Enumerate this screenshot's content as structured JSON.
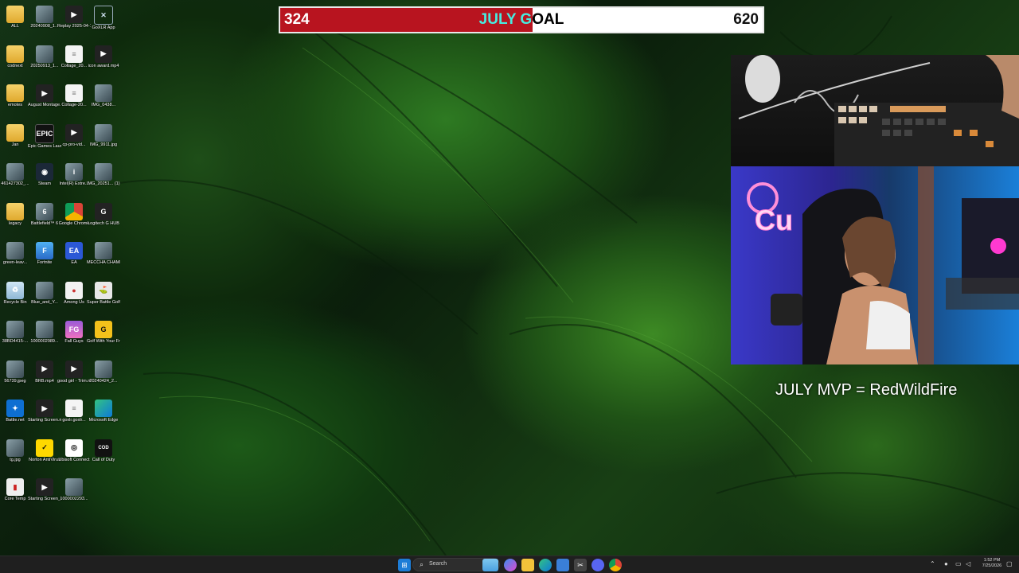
{
  "goal": {
    "current": "324",
    "title": "JULY GOAL",
    "target": "620",
    "progress_fraction": 0.523,
    "fill_color": "#b8141f"
  },
  "overlay": {
    "mvp_text": "JULY MVP = RedWildFire"
  },
  "desktop": {
    "icons": [
      {
        "label": "ALL",
        "icon": "folder-icon"
      },
      {
        "label": "20240908_1...",
        "icon": "image-icon"
      },
      {
        "label": "Replay 2025-04-11...",
        "icon": "video-icon"
      },
      {
        "label": "GoXLR App",
        "icon": "goxlr-icon"
      },
      {
        "label": "codnext",
        "icon": "folder-icon"
      },
      {
        "label": "20250913_1...",
        "icon": "image-icon"
      },
      {
        "label": "Collage_20...",
        "icon": "document-icon"
      },
      {
        "label": "icon award.mp4",
        "icon": "video-icon"
      },
      {
        "label": "emotes",
        "icon": "folder-icon"
      },
      {
        "label": "August Montage...",
        "icon": "video-icon"
      },
      {
        "label": "Collage-20...",
        "icon": "document-icon"
      },
      {
        "label": "IMG_0438...",
        "icon": "image-icon"
      },
      {
        "label": "Jan",
        "icon": "folder-icon"
      },
      {
        "label": "Epic Games Launcher",
        "icon": "epic-games-icon"
      },
      {
        "label": "cp-pro-vid...",
        "icon": "video-icon"
      },
      {
        "label": "IMG_9911.jpg",
        "icon": "image-icon"
      },
      {
        "label": "461427302_...",
        "icon": "image-icon"
      },
      {
        "label": "Steam",
        "icon": "steam-icon"
      },
      {
        "label": "Intel(R) Extre...",
        "icon": "intel-icon"
      },
      {
        "label": "IMG_20251... (1).webp",
        "icon": "image-icon"
      },
      {
        "label": "legacy",
        "icon": "folder-icon"
      },
      {
        "label": "Battlefield™ 6",
        "icon": "battlefield-icon"
      },
      {
        "label": "Google Chrome",
        "icon": "chrome-icon"
      },
      {
        "label": "Logitech G HUB",
        "icon": "logitech-icon"
      },
      {
        "label": "green-leav...",
        "icon": "image-icon"
      },
      {
        "label": "Fortnite",
        "icon": "fortnite-icon"
      },
      {
        "label": "EA",
        "icon": "ea-icon"
      },
      {
        "label": "MECCHA CHAMELE...",
        "icon": "image-icon"
      },
      {
        "label": "Recycle Bin",
        "icon": "recycle-bin-icon"
      },
      {
        "label": "Blue_and_Y...",
        "icon": "image-icon"
      },
      {
        "label": "Among Us",
        "icon": "among-us-icon"
      },
      {
        "label": "Super Battle Golf",
        "icon": "golf-icon"
      },
      {
        "label": "38BD4415-...",
        "icon": "image-icon"
      },
      {
        "label": "1000002989...",
        "icon": "image-icon"
      },
      {
        "label": "Fall Guys",
        "icon": "fall-guys-icon"
      },
      {
        "label": "Golf With Your Friends",
        "icon": "golf-with-friends-icon"
      },
      {
        "label": "56739.jpeg",
        "icon": "image-icon"
      },
      {
        "label": "BRB.mp4",
        "icon": "video-icon"
      },
      {
        "label": "good girl - Trim.mp4",
        "icon": "video-icon"
      },
      {
        "label": "20240424_2...",
        "icon": "image-icon"
      },
      {
        "label": "Battle.net",
        "icon": "battlenet-icon"
      },
      {
        "label": "Starting Screen.mp4",
        "icon": "video-icon"
      },
      {
        "label": "goxlr.goxlr...",
        "icon": "document-icon"
      },
      {
        "label": "Microsoft Edge",
        "icon": "edge-icon"
      },
      {
        "label": "tg.jpg",
        "icon": "image-icon"
      },
      {
        "label": "Norton AntiVirus",
        "icon": "norton-icon"
      },
      {
        "label": "Ubisoft Connect",
        "icon": "ubisoft-icon"
      },
      {
        "label": "Call of Duty",
        "icon": "call-of-duty-icon"
      },
      {
        "label": "Core Temp",
        "icon": "core-temp-icon"
      },
      {
        "label": "Starting Screen_cp_...",
        "icon": "video-icon"
      },
      {
        "label": "1000002293...",
        "icon": "image-icon"
      }
    ]
  },
  "taskbar": {
    "search_label": "Search",
    "apps": [
      "start-icon",
      "search-icon",
      "widgets-icon",
      "copilot-icon",
      "file-explorer-icon",
      "edge-icon",
      "store-icon",
      "snipping-icon",
      "discord-icon",
      "chrome-icon"
    ],
    "clock_time": "1:52 PM",
    "clock_date": "7/25/2026"
  }
}
